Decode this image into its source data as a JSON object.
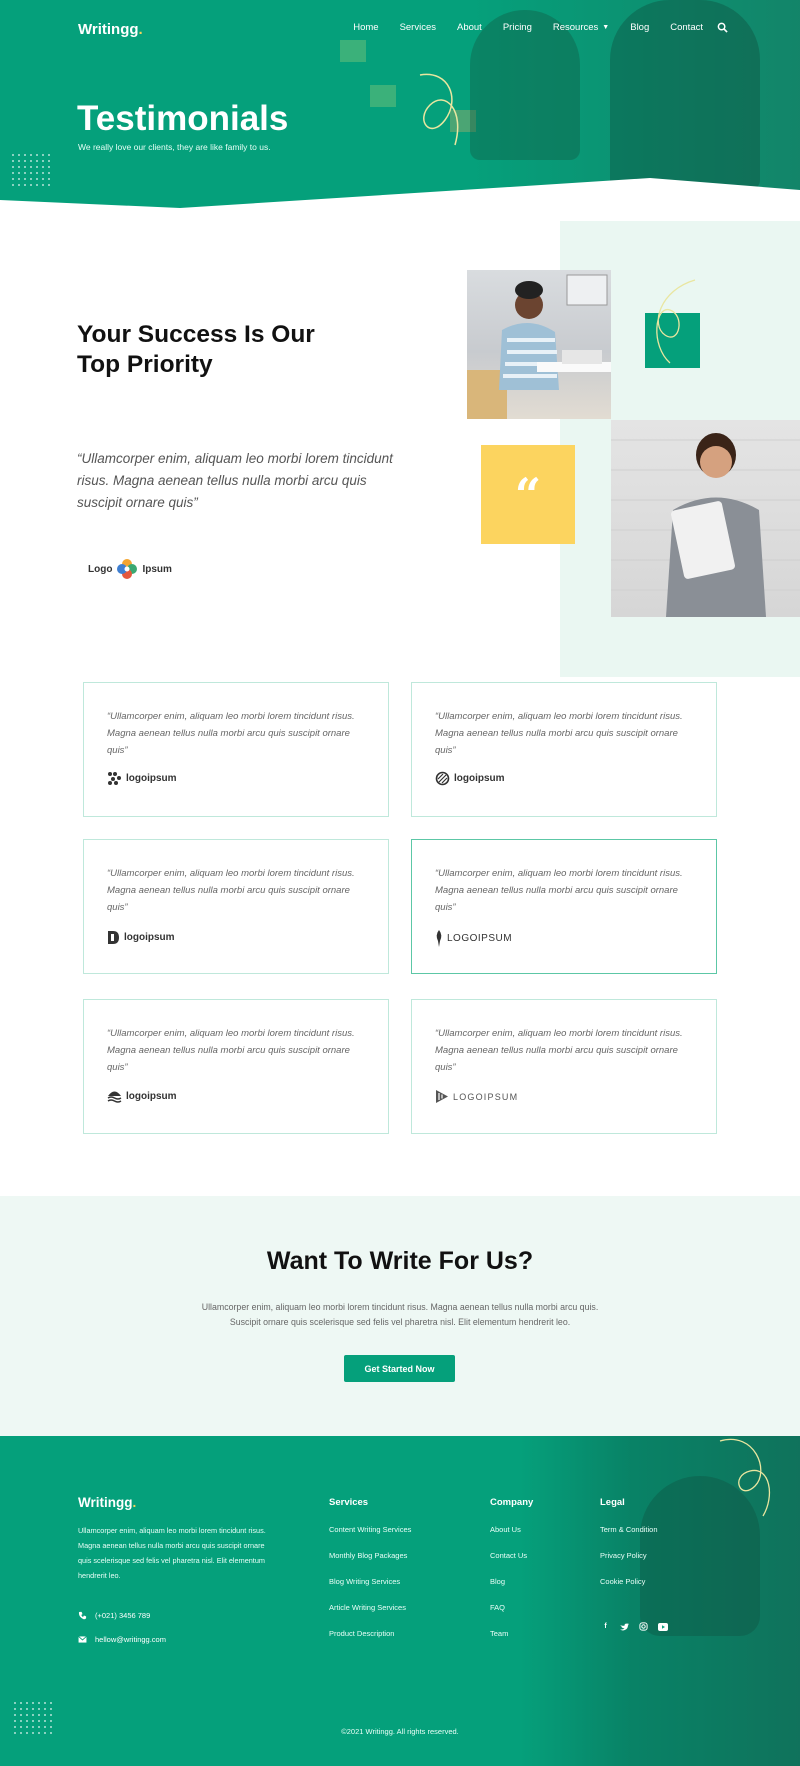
{
  "brand": {
    "name": "Writingg",
    "dot": "."
  },
  "nav": {
    "items": [
      "Home",
      "Services",
      "About",
      "Pricing",
      "Resources",
      "Blog",
      "Contact"
    ]
  },
  "hero": {
    "title": "Testimonials",
    "subtitle": "We really love our clients, they are like family to us."
  },
  "success": {
    "title_line1": "Your Success Is Our",
    "title_line2": "Top Priority",
    "quote": "“Ullamcorper enim, aliquam leo morbi lorem tincidunt risus. Magna aenean tellus nulla morbi arcu quis suscipit ornare quis”",
    "logo_left": "Logo",
    "logo_right": "Ipsum"
  },
  "testimonials": [
    {
      "text": "“Ullamcorper enim, aliquam leo morbi lorem tincidunt risus. Magna aenean tellus nulla morbi arcu quis suscipit ornare quis”",
      "logo": "logoipsum",
      "logo_icon": "dots-grid-icon"
    },
    {
      "text": "“Ullamcorper enim, aliquam leo morbi lorem tincidunt risus. Magna aenean tellus nulla morbi arcu quis suscipit ornare quis”",
      "logo": "logoipsum",
      "logo_icon": "striped-circle-icon"
    },
    {
      "text": "“Ullamcorper enim, aliquam leo morbi lorem tincidunt risus. Magna aenean tellus nulla morbi arcu quis suscipit ornare quis”",
      "logo": "logoipsum",
      "logo_icon": "d-shape-icon"
    },
    {
      "text": "“Ullamcorper enim, aliquam leo morbi lorem tincidunt risus. Magna aenean tellus nulla morbi arcu quis suscipit ornare quis”",
      "logo": "LOGOIPSUM",
      "logo_icon": "feather-icon"
    },
    {
      "text": "“Ullamcorper enim, aliquam leo morbi lorem tincidunt risus. Magna aenean tellus nulla morbi arcu quis suscipit ornare quis”",
      "logo": "logoipsum",
      "logo_icon": "waves-icon"
    },
    {
      "text": "“Ullamcorper enim, aliquam leo morbi lorem tincidunt risus. Magna aenean tellus nulla morbi arcu quis suscipit ornare quis”",
      "logo": "LOGOIPSUM",
      "logo_icon": "play-stack-icon"
    }
  ],
  "cta": {
    "title": "Want To Write For Us?",
    "text": "Ullamcorper enim, aliquam leo morbi lorem tincidunt risus. Magna aenean tellus nulla morbi arcu quis. Suscipit ornare quis scelerisque sed felis vel pharetra nisl. Elit elementum hendrerit leo.",
    "button": "Get Started Now"
  },
  "footer": {
    "description": "Ullamcorper enim, aliquam leo morbi lorem tincidunt risus. Magna aenean tellus nulla morbi arcu quis suscipit ornare quis scelerisque sed felis vel pharetra nisl. Elit elementum hendrerit leo.",
    "phone": "(+021) 3456 789",
    "email": "hellow@writingg.com",
    "services_title": "Services",
    "services": [
      "Content Writing Services",
      "Monthly Blog Packages",
      "Blog Writing Services",
      "Article Writing Services",
      "Product Description"
    ],
    "company_title": "Company",
    "company": [
      "About Us",
      "Contact Us",
      "Blog",
      "FAQ",
      "Team"
    ],
    "legal_title": "Legal",
    "legal": [
      "Term & Condition",
      "Privacy Policy",
      "Cookie Policy"
    ],
    "social": [
      "facebook-icon",
      "twitter-icon",
      "instagram-icon",
      "youtube-icon"
    ],
    "copyright": "©2021 Writingg. All rights reserved."
  },
  "colors": {
    "primary": "#05a07b",
    "accent_yellow": "#fcd45f",
    "mint": "#eaf7f2"
  }
}
